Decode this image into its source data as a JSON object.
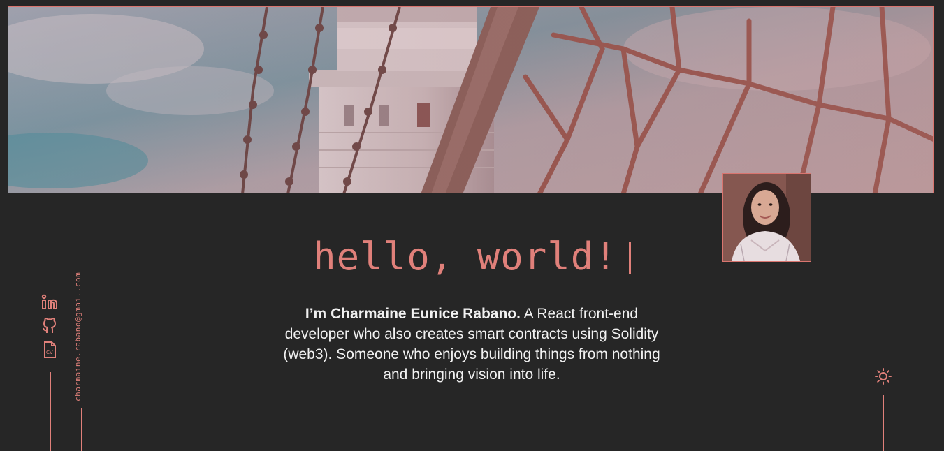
{
  "hero": {
    "headline": "hello, world!",
    "intro_name": "I’m Charmaine Eunice Rabano.",
    "intro_text": " A React front-end developer who also creates smart contracts using Solidity (web3). Someone who enjoys building things from nothing and bringing vision into life."
  },
  "social": {
    "linkedin_icon": "linkedin-icon",
    "github_icon": "github-icon",
    "cv_icon": "cv-file-icon",
    "cv_label": "CV",
    "email": "charmaine.rabano@gmail.com"
  },
  "theme": {
    "toggle_icon": "sun-icon"
  },
  "colors": {
    "background": "#262626",
    "accent": "#e0807a",
    "text": "#f1f1f1"
  }
}
